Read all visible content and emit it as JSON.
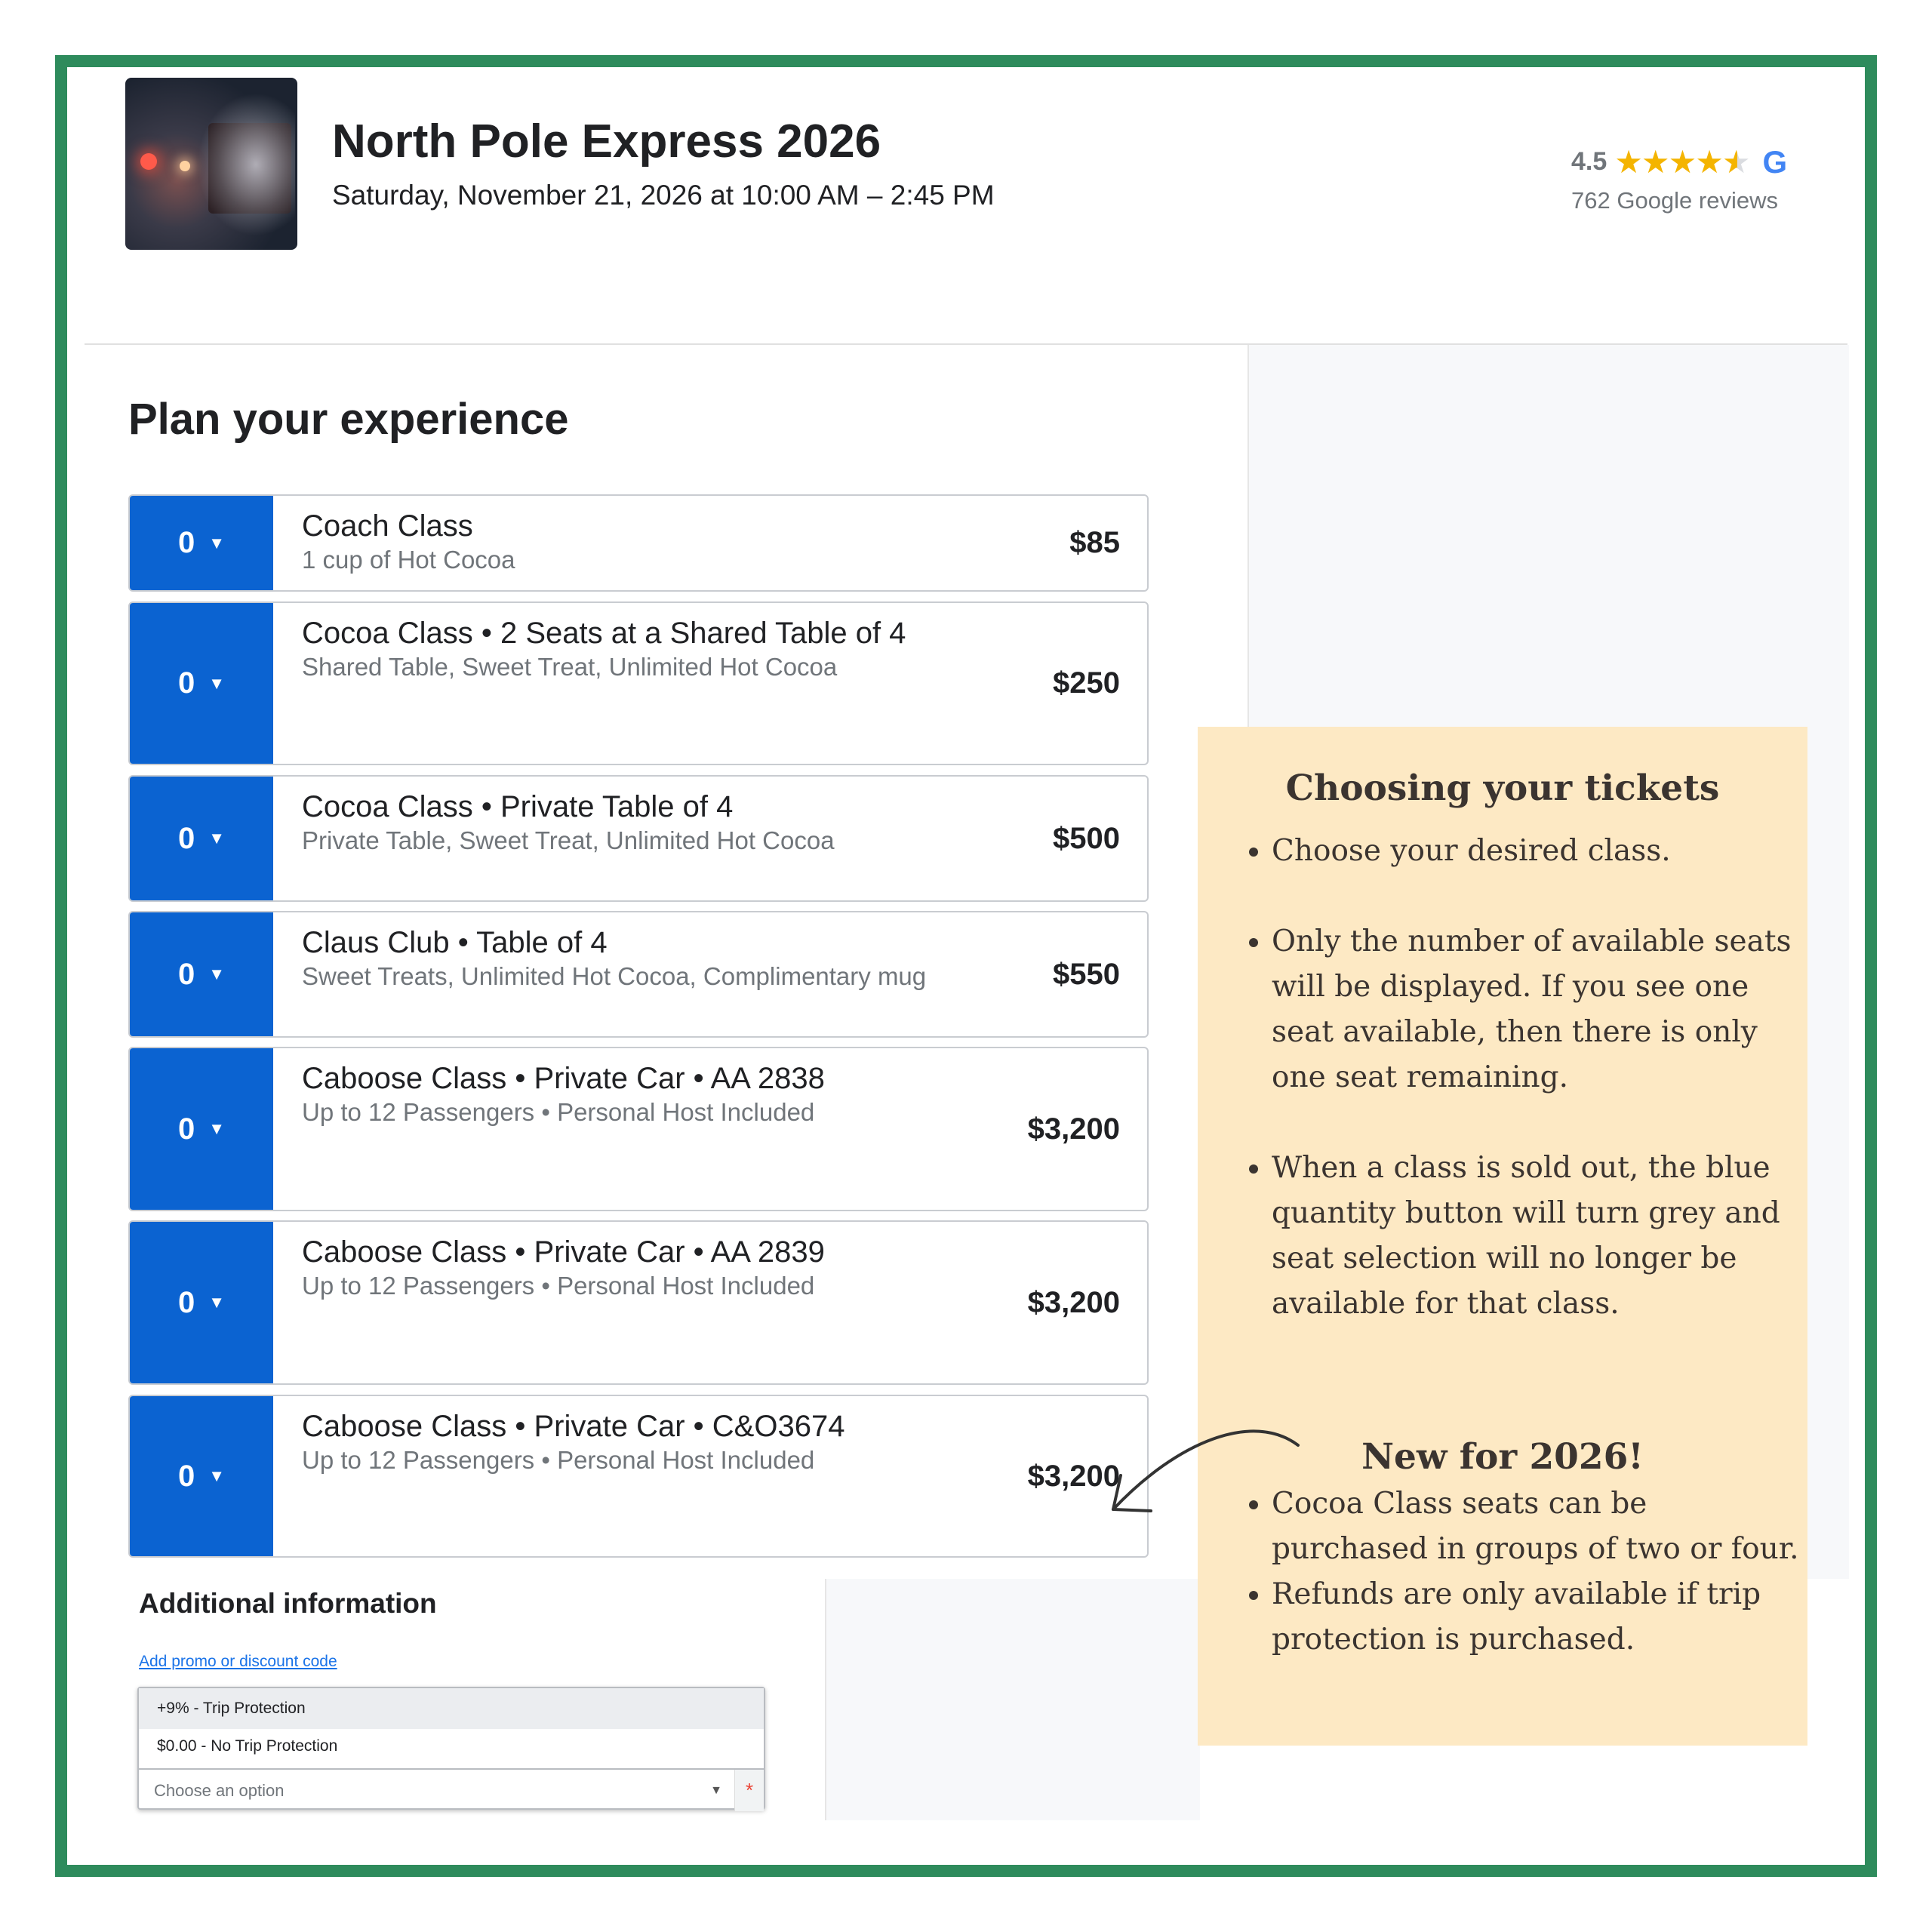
{
  "event": {
    "title": "North Pole Express 2026",
    "datetime": "Saturday, November 21, 2026 at 10:00 AM – 2:45 PM",
    "rating": "4.5",
    "reviews": "762 Google reviews",
    "google_logo": "G",
    "thumbnail_icon": "train-photo"
  },
  "plan": {
    "heading": "Plan your experience",
    "tickets": [
      {
        "qty": "0",
        "name": "Coach Class",
        "desc": "1 cup of Hot Cocoa",
        "price": "$85"
      },
      {
        "qty": "0",
        "name": "Cocoa Class • 2 Seats at a Shared Table of 4",
        "desc": "Shared Table, Sweet Treat, Unlimited Hot Cocoa",
        "price": "$250"
      },
      {
        "qty": "0",
        "name": "Cocoa Class • Private Table of 4",
        "desc": "Private Table, Sweet Treat, Unlimited Hot Cocoa",
        "price": "$500"
      },
      {
        "qty": "0",
        "name": "Claus Club • Table of 4",
        "desc": "Sweet Treats, Unlimited Hot Cocoa, Complimentary mug",
        "price": "$550"
      },
      {
        "qty": "0",
        "name": "Caboose Class • Private Car • AA 2838",
        "desc": "Up to 12 Passengers • Personal Host Included",
        "price": "$3,200"
      },
      {
        "qty": "0",
        "name": "Caboose Class • Private Car • AA 2839",
        "desc": "Up to 12 Passengers • Personal Host Included",
        "price": "$3,200"
      },
      {
        "qty": "0",
        "name": "Caboose Class • Private Car • C&O3674",
        "desc": "Up to 12 Passengers • Personal Host Included",
        "price": "$3,200"
      }
    ]
  },
  "additional": {
    "heading": "Additional information",
    "promo_link": "Add promo or discount code",
    "options": [
      "+9% - Trip Protection",
      "$0.00 - No Trip Protection"
    ],
    "select_placeholder": "Choose an option",
    "required_mark": "*"
  },
  "note": {
    "heading": "Choosing your tickets",
    "bullets": [
      "Choose your desired class.",
      "Only the number of available seats will be displayed. If you see one seat available, then there is only one seat remaining.",
      "When a class is sold out, the blue quantity button will turn grey and seat selection will no longer be available for that class."
    ],
    "new_heading": "New for 2026!",
    "new_bullets": [
      "Cocoa Class seats can be purchased in groups of two or four.",
      "Refunds are only available if trip protection is purchased."
    ]
  },
  "colors": {
    "frame": "#2e8b5c",
    "quantity_button": "#0b63d1",
    "note_background": "#fde9c4",
    "star": "#f4b400"
  }
}
